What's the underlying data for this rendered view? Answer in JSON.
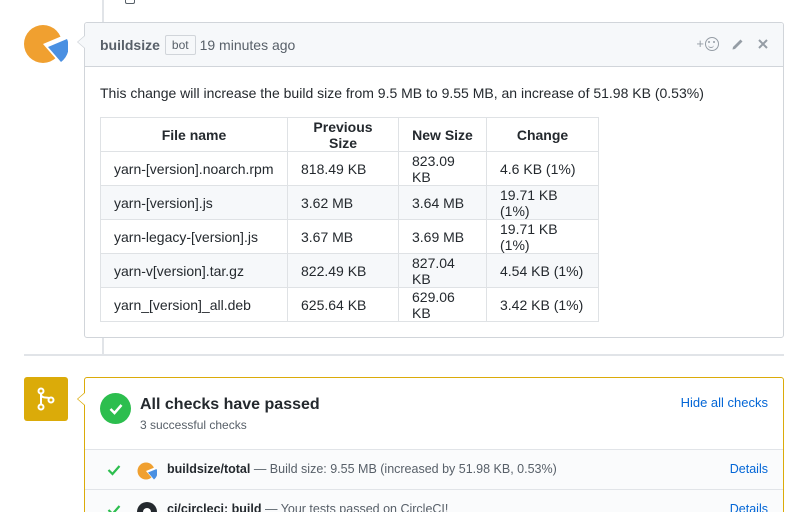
{
  "comment": {
    "author": "buildsize",
    "badge": "bot",
    "timestamp": "19 minutes ago",
    "react_plus": "+",
    "body_text": "This change will increase the build size from 9.5 MB to 9.55 MB, an increase of 51.98 KB (0.53%)",
    "table": {
      "headers": [
        "File name",
        "Previous Size",
        "New Size",
        "Change"
      ],
      "rows": [
        [
          "yarn-[version].noarch.rpm",
          "818.49 KB",
          "823.09 KB",
          "4.6 KB (1%)"
        ],
        [
          "yarn-[version].js",
          "3.62 MB",
          "3.64 MB",
          "19.71 KB (1%)"
        ],
        [
          "yarn-legacy-[version].js",
          "3.67 MB",
          "3.69 MB",
          "19.71 KB (1%)"
        ],
        [
          "yarn-v[version].tar.gz",
          "822.49 KB",
          "827.04 KB",
          "4.54 KB (1%)"
        ],
        [
          "yarn_[version]_all.deb",
          "625.64 KB",
          "629.06 KB",
          "3.42 KB (1%)"
        ]
      ]
    }
  },
  "checks": {
    "title": "All checks have passed",
    "subtitle": "3 successful checks",
    "hide_label": "Hide all checks",
    "rows": [
      {
        "name": "buildsize/total",
        "desc": " — Build size: 9.55 MB (increased by 51.98 KB, 0.53%)",
        "details": "Details"
      },
      {
        "name": "ci/circleci: build",
        "desc": " — Your tests passed on CircleCI!",
        "details": "Details"
      }
    ]
  },
  "colors": {
    "accent_link": "#0366d6",
    "success": "#2cbe4e",
    "merge_box": "#dbab09",
    "avatar_orange": "#f5a623",
    "avatar_blue": "#4a90e2"
  }
}
